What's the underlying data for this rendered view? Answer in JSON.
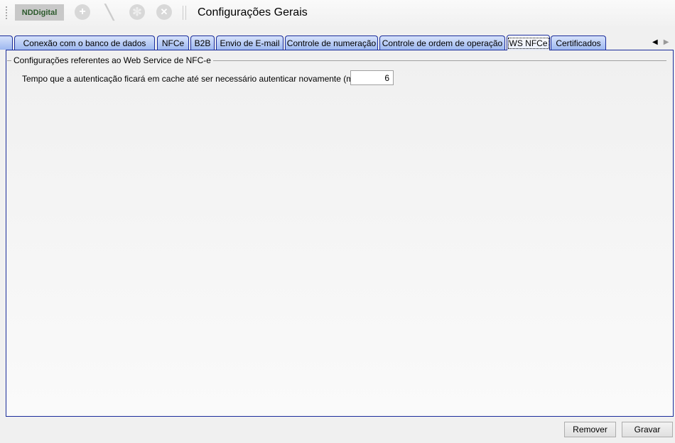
{
  "toolbar": {
    "logo": "NDDigital",
    "title": "Configurações Gerais",
    "icons": [
      "add-icon",
      "edit-icon",
      "settings-icon",
      "close-icon"
    ]
  },
  "tabs": [
    {
      "label": "Conexão com o banco de dados"
    },
    {
      "label": "NFCe"
    },
    {
      "label": "B2B"
    },
    {
      "label": "Envio de E-mail"
    },
    {
      "label": "Controle de numeração"
    },
    {
      "label": "Controle de ordem de operação"
    },
    {
      "label": "WS NFCe",
      "selected": true
    },
    {
      "label": "Certificados"
    }
  ],
  "panel": {
    "group_title": "Configurações referentes ao Web Service de NFC-e",
    "field_label": "Tempo que a autenticação ficará em cache até ser necessário autenticar novamente (min):",
    "field_value": "6"
  },
  "buttons": {
    "remove": "Remover",
    "save": "Gravar"
  }
}
